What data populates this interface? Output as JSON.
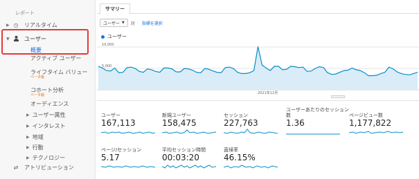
{
  "sidebar": {
    "header": "レポート",
    "realtime": "リアルタイム",
    "user": "ユーザー",
    "sub_items": {
      "overview": "概要",
      "active_users": "アクティブ ユーザー",
      "lifetime": "ライフタイム バリュー",
      "lifetime_badge": "ベータ版",
      "cohort": "コホート分析",
      "cohort_badge": "ベータ版",
      "audience": "オーディエンス"
    },
    "expandables": [
      "ユーザー属性",
      "インタレスト",
      "地域",
      "行動",
      "テクノロジー"
    ],
    "attribution": "アトリビューション"
  },
  "tabs": {
    "summary": "サマリー"
  },
  "controls": {
    "metric_select": "ユーザー",
    "vs": "対",
    "add_metric": "指標を選択"
  },
  "chart": {
    "legend": "ユーザー",
    "y_top": "10,000",
    "y_mid": "5,000",
    "x_label": "2021年12月"
  },
  "chart_data": {
    "type": "area",
    "series": [
      {
        "name": "ユーザー",
        "values": [
          5500,
          5100,
          4500,
          4400,
          5100,
          4000,
          4100,
          5200,
          5300,
          5000,
          4300,
          4100,
          4900,
          4700,
          4300,
          4100,
          5100,
          5100,
          4900,
          4200,
          4200,
          5000,
          4900,
          4600,
          4100,
          4000,
          5000,
          4800,
          4400,
          4100,
          4000,
          5200,
          5300,
          5000,
          4100,
          3800,
          3800,
          4000,
          4500,
          10100,
          5800,
          5100,
          4500,
          5500,
          5500,
          4700,
          4800,
          5500,
          5400,
          5200,
          5300,
          4300,
          4400,
          5000,
          5400,
          5200,
          4000,
          3600,
          3700,
          4100,
          4500,
          4600,
          5100,
          4700,
          4500,
          4000,
          3300,
          3300,
          3400,
          3800,
          4100,
          5300,
          4900,
          4200,
          3800,
          3600,
          3500,
          3800,
          4100
        ]
      }
    ],
    "ylim": [
      0,
      11000
    ],
    "grid": true,
    "legend_position": "top-left",
    "color": "#058dc7"
  },
  "metrics": [
    {
      "label": "ユーザー",
      "value": "167,113"
    },
    {
      "label": "新規ユーザー",
      "value": "158,475"
    },
    {
      "label": "セッション",
      "value": "227,763"
    },
    {
      "label": "ユーザーあたりのセッション数",
      "value": "1.36"
    },
    {
      "label": "ページビュー数",
      "value": "1,177,822"
    },
    {
      "label": "ページ/セッション",
      "value": "5.17"
    },
    {
      "label": "平均セッション時間",
      "value": "00:03:20"
    },
    {
      "label": "直帰率",
      "value": "46.15%"
    }
  ]
}
